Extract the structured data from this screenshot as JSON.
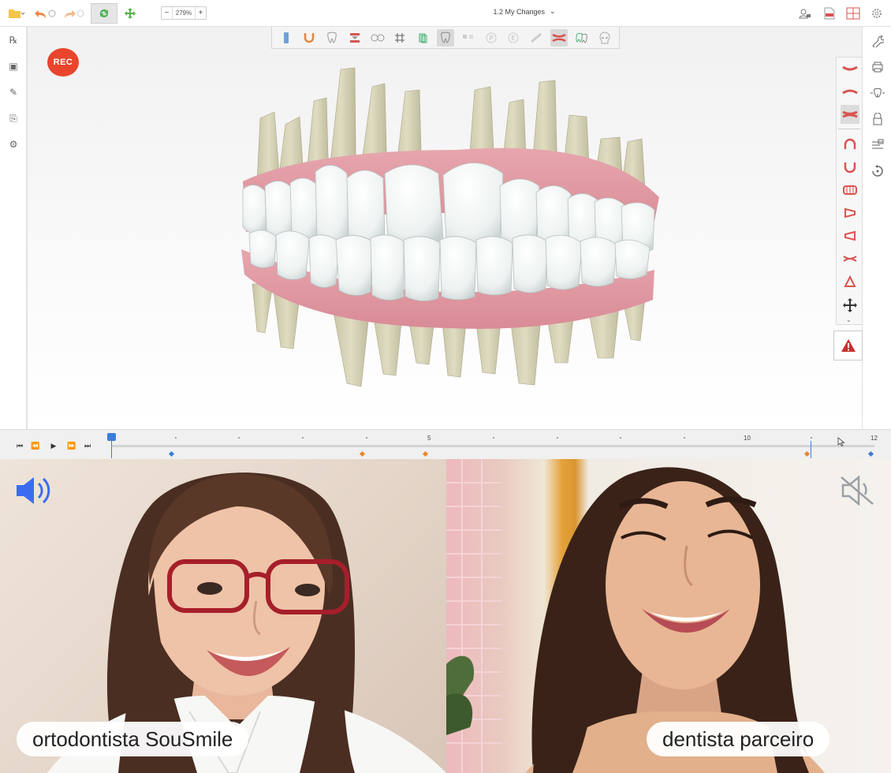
{
  "toolbar": {
    "zoom_minus": "−",
    "zoom_value": "279%",
    "zoom_plus": "+",
    "changes_label": "1.2 My Changes",
    "changes_caret": "⌄"
  },
  "overlay": {
    "rec_label": "REC"
  },
  "left_tools": [
    {
      "icon": "prescription-icon",
      "glyph": "℞"
    },
    {
      "icon": "patient-card-icon",
      "glyph": "▣"
    },
    {
      "icon": "pen-icon",
      "glyph": "✎"
    },
    {
      "icon": "add-file-icon",
      "glyph": "⎘"
    },
    {
      "icon": "settings-gears-icon",
      "glyph": "⚙"
    }
  ],
  "right_tools": [
    {
      "icon": "wrench-icon",
      "glyph": "🔧"
    },
    {
      "icon": "print-icon",
      "glyph": "⎙"
    },
    {
      "icon": "tooth-chart-icon",
      "glyph": "⌖"
    },
    {
      "icon": "lock-icon",
      "glyph": "⊡"
    },
    {
      "icon": "ruler-icon",
      "glyph": "≡"
    },
    {
      "icon": "reset-icon",
      "glyph": "↻"
    }
  ],
  "timeline": {
    "labels": [
      "5",
      "10",
      "12"
    ],
    "start_step": "0",
    "current_step": 11,
    "total_steps": 12
  },
  "participants": {
    "left": {
      "name": "ortodontista SouSmile",
      "audio": "speaking"
    },
    "right": {
      "name": "dentista parceiro",
      "audio": "muted"
    }
  },
  "colors": {
    "accent_blue": "#3b7dd8",
    "rec_red": "#e8452c",
    "gum_pink": "#e8a3ad",
    "tooth_white": "#f2f6f6",
    "root_beige": "#d6d3b6",
    "speaker_blue": "#3b6cf0",
    "key_orange": "#e6882e"
  }
}
